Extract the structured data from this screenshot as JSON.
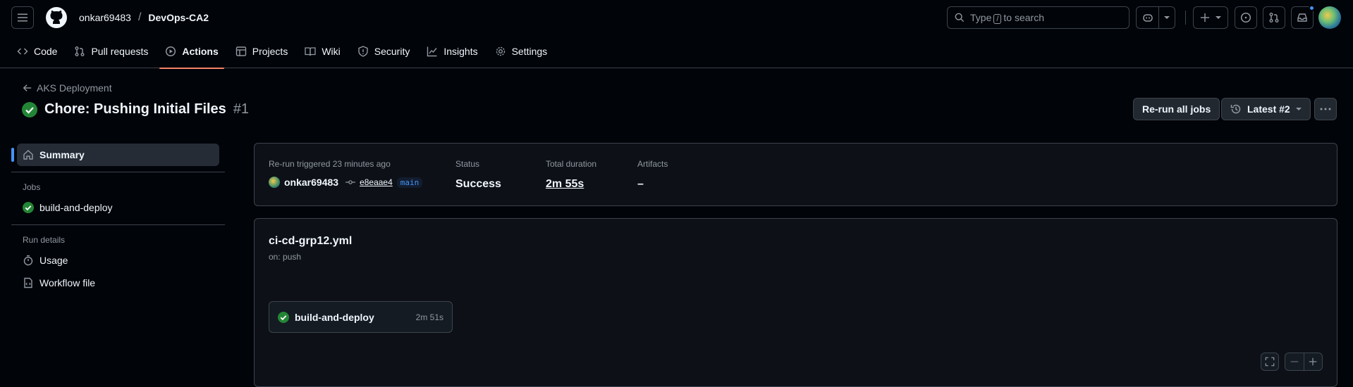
{
  "header": {
    "owner": "onkar69483",
    "separator": "/",
    "repo": "DevOps-CA2",
    "search_prefix": "Type",
    "search_key": "/",
    "search_suffix": "to search"
  },
  "nav": {
    "tabs": [
      {
        "label": "Code",
        "icon": "code-icon"
      },
      {
        "label": "Pull requests",
        "icon": "pull-request-icon"
      },
      {
        "label": "Actions",
        "icon": "play-icon",
        "active": true
      },
      {
        "label": "Projects",
        "icon": "table-icon"
      },
      {
        "label": "Wiki",
        "icon": "book-icon"
      },
      {
        "label": "Security",
        "icon": "shield-icon"
      },
      {
        "label": "Insights",
        "icon": "graph-icon"
      },
      {
        "label": "Settings",
        "icon": "gear-icon"
      }
    ]
  },
  "run": {
    "back_label": "AKS Deployment",
    "title": "Chore: Pushing Initial Files",
    "number": "#1",
    "rerun_label": "Re-run all jobs",
    "latest_label": "Latest #2"
  },
  "sidebar": {
    "summary_label": "Summary",
    "jobs_heading": "Jobs",
    "job_label": "build-and-deploy",
    "run_details_heading": "Run details",
    "usage_label": "Usage",
    "workflow_file_label": "Workflow file"
  },
  "summary": {
    "trigger_label": "Re-run triggered 23 minutes ago",
    "actor": "onkar69483",
    "commit": "e8eaae4",
    "branch": "main",
    "status_label": "Status",
    "status_value": "Success",
    "duration_label": "Total duration",
    "duration_value": "2m 55s",
    "artifacts_label": "Artifacts",
    "artifacts_value": "–"
  },
  "workflow": {
    "file": "ci-cd-grp12.yml",
    "trigger": "on: push",
    "job_name": "build-and-deploy",
    "job_duration": "2m 51s"
  },
  "colors": {
    "background": "#010409",
    "success": "#238636",
    "accent_underline": "#f78166",
    "link_blue": "#4493f8"
  }
}
